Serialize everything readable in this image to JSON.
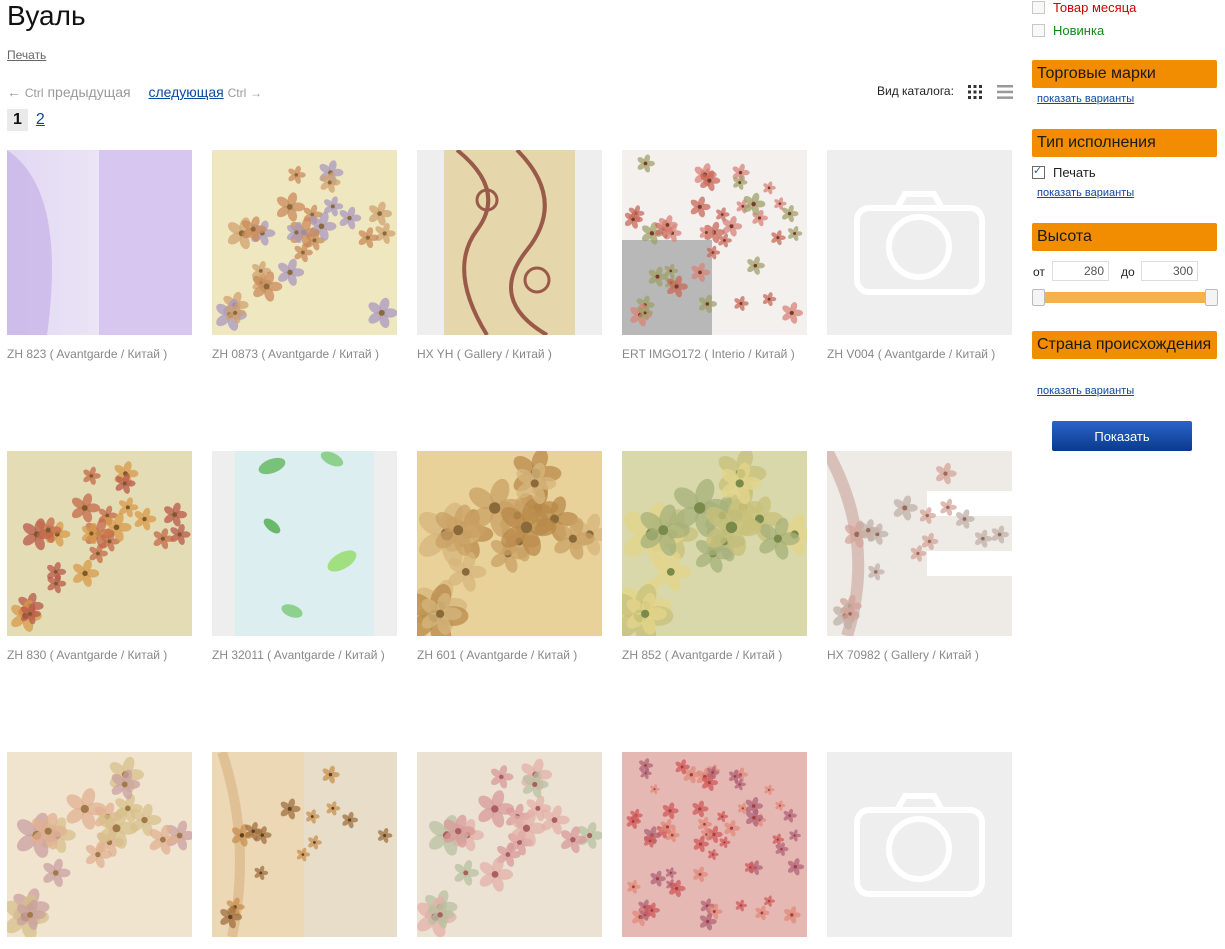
{
  "page": {
    "title": "Вуаль",
    "print_label": "Печать",
    "prev_arrow": "←",
    "prev_ctrl": "Ctrl",
    "prev_label": "предыдущая",
    "next_label": "следующая",
    "next_ctrl": "Ctrl",
    "next_arrow": "→",
    "view_label": "Вид каталога:",
    "pages": [
      "1",
      "2"
    ]
  },
  "products": [
    {
      "caption": "ZH 823 ( Avantgarde / Китай )",
      "pattern": "sheer-violet"
    },
    {
      "caption": "ZH 0873 ( Avantgarde / Китай )",
      "pattern": "floral-cream"
    },
    {
      "caption": "HX YH ( Gallery / Китай )",
      "pattern": "swirl-beige"
    },
    {
      "caption": "ERT IMGO172 ( Interio / Китай )",
      "pattern": "rose-curtain"
    },
    {
      "caption": "ZH V004 ( Avantgarde / Китай )",
      "pattern": "placeholder"
    },
    {
      "caption": "ZH 830 ( Avantgarde / Китай )",
      "pattern": "floral-sage"
    },
    {
      "caption": "ZH 32011 ( Avantgarde / Китай )",
      "pattern": "leaf-blue"
    },
    {
      "caption": "ZH 601 ( Avantgarde / Китай )",
      "pattern": "floral-gold"
    },
    {
      "caption": "ZH 852 ( Avantgarde / Китай )",
      "pattern": "floral-green"
    },
    {
      "caption": "HX 70982 ( Gallery / Китай )",
      "pattern": "swirl-curtain"
    },
    {
      "caption": "",
      "pattern": "floral-peach"
    },
    {
      "caption": "",
      "pattern": "butterfly-beige"
    },
    {
      "caption": "",
      "pattern": "rose-pink"
    },
    {
      "caption": "",
      "pattern": "confetti-red"
    },
    {
      "caption": "",
      "pattern": "placeholder"
    }
  ],
  "sidebar": {
    "month_label": "Товар месяца",
    "new_label": "Новинка",
    "brands_header": "Торговые марки",
    "brands_variants": "показать варианты",
    "type_header": "Тип исполнения",
    "type_option": "Печать",
    "type_variants": "показать варианты",
    "height_header": "Высота",
    "from_label": "от",
    "from_value": "280",
    "to_label": "до",
    "to_value": "300",
    "country_header": "Страна происхождения",
    "country_variants": "показать варианты",
    "show_button": "Показать"
  },
  "colors": {
    "accent": "#f28c00",
    "link": "#0a4aa0",
    "month": "#cc0000",
    "new": "#118811"
  }
}
